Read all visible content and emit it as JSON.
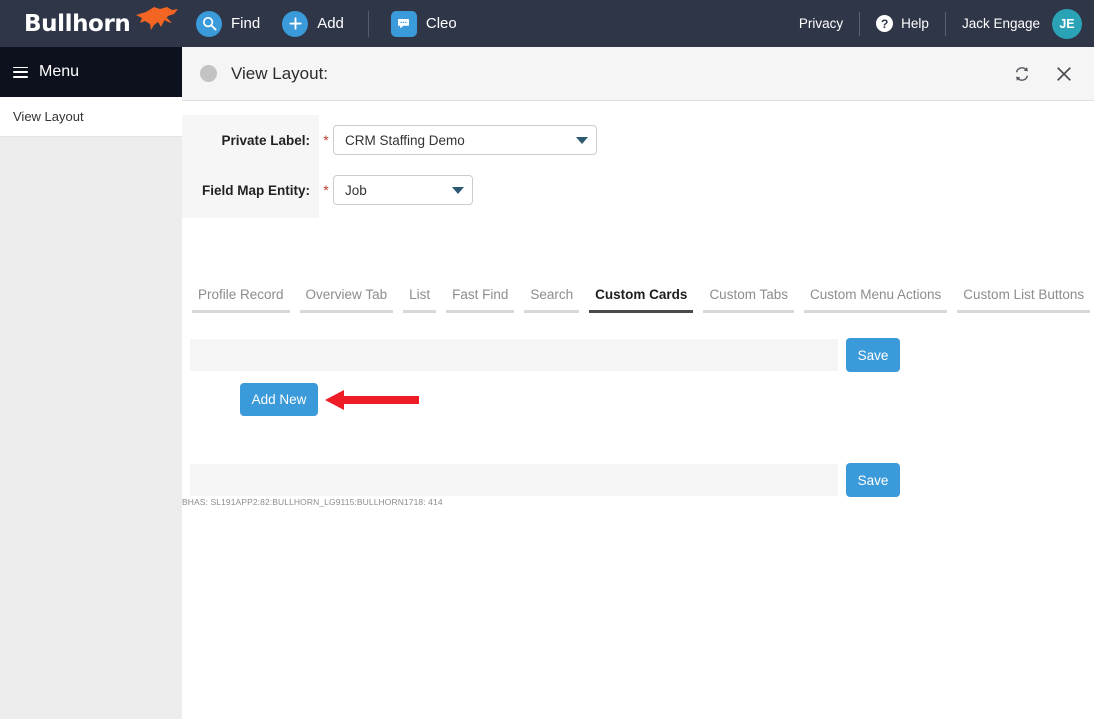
{
  "topbar": {
    "brand": "Bullhorn",
    "brand_logo_color": "#f26522",
    "bg_color": "#2f3647",
    "nav": [
      {
        "label": "Find",
        "icon": "search-icon"
      },
      {
        "label": "Add",
        "icon": "plus-icon"
      },
      {
        "label": "Cleo",
        "icon": "chat-icon"
      }
    ],
    "right": {
      "privacy": "Privacy",
      "help": "Help",
      "user_name": "Jack Engage",
      "avatar_initials": "JE",
      "avatar_color": "#2aa3b7"
    }
  },
  "sidebar": {
    "menu_label": "Menu",
    "items": [
      {
        "label": "View Layout"
      }
    ]
  },
  "panel": {
    "title": "View Layout:",
    "refresh_icon": "refresh-icon",
    "close_icon": "close-icon"
  },
  "form": {
    "fields": [
      {
        "label": "Private Label:",
        "required": "*",
        "value": "CRM Staffing Demo"
      },
      {
        "label": "Field Map Entity:",
        "required": "*",
        "value": "Job"
      }
    ]
  },
  "tabs": [
    {
      "label": "Profile Record",
      "active": false
    },
    {
      "label": "Overview Tab",
      "active": false
    },
    {
      "label": "List",
      "active": false
    },
    {
      "label": "Fast Find",
      "active": false
    },
    {
      "label": "Search",
      "active": false
    },
    {
      "label": "Custom Cards",
      "active": true
    },
    {
      "label": "Custom Tabs",
      "active": false
    },
    {
      "label": "Custom Menu Actions",
      "active": false
    },
    {
      "label": "Custom List Buttons",
      "active": false
    }
  ],
  "content": {
    "save_top_label": "Save",
    "save_bottom_label": "Save",
    "add_new_label": "Add New",
    "annotation_arrow_color": "#ee1c25",
    "status_text": "BHAS:  SL191APP2:82:BULLHORN_LG9115:BULLHORN1718: 414"
  }
}
